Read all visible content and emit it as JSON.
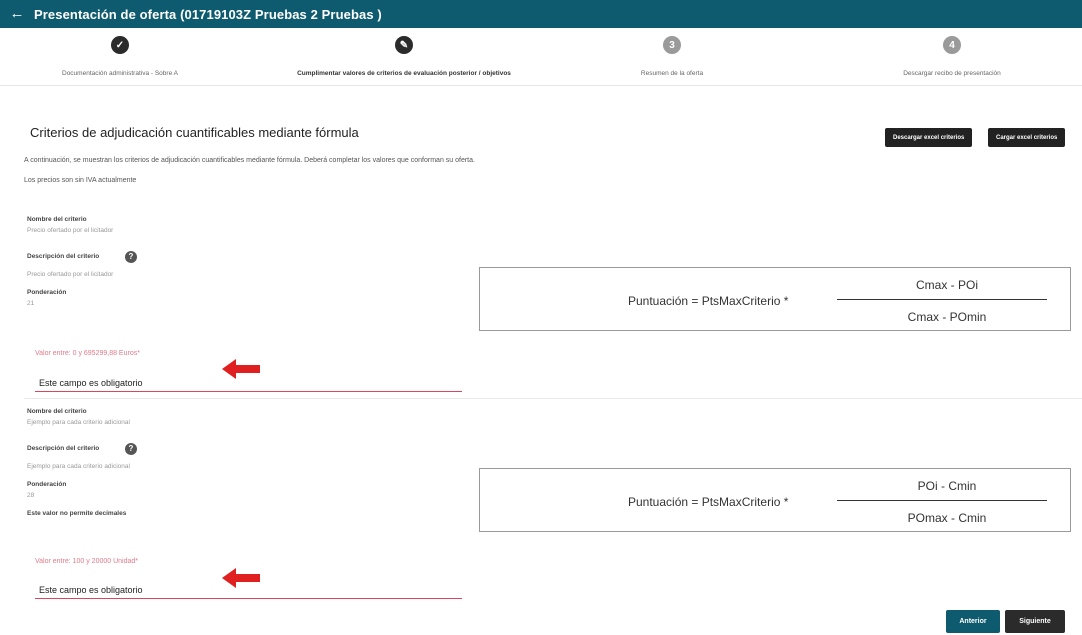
{
  "header": {
    "back_icon": "arrow-left-icon",
    "title": "Presentación de oferta (01719103Z Pruebas 2 Pruebas )"
  },
  "steps": [
    {
      "label": "Documentación administrativa - Sobre A",
      "status": "done",
      "icon": "check-icon",
      "glyph": "✓"
    },
    {
      "label": "Cumplimentar valores de criterios de evaluación posterior / objetivos",
      "status": "done",
      "icon": "edit-icon",
      "glyph": "✎"
    },
    {
      "label": "Resumen de la oferta",
      "status": "todo",
      "icon": "step-3-icon",
      "glyph": "3"
    },
    {
      "label": "Descargar recibo de presentación",
      "status": "todo",
      "icon": "step-4-icon",
      "glyph": "4"
    }
  ],
  "section": {
    "title": "Criterios de adjudicación cuantificables mediante fórmula",
    "download_excel": "Descargar excel criterios",
    "upload_excel": "Cargar excel criterios",
    "intro_text": "A continuación, se muestran los criterios de adjudicación cuantificables mediante fórmula. Deberá completar los valores que conforman su oferta.",
    "vat_note": "Los precios son sin IVA actualmente"
  },
  "criteria": [
    {
      "name_label": "Nombre del criterio",
      "name_value": "Precio ofertado por el licitador",
      "desc_label": "Descripción del criterio",
      "desc_value": "Precio ofertado por el licitador",
      "weight_label": "Ponderación",
      "weight_value": "21",
      "extra_note": "",
      "formula": {
        "lhs": "Puntuación = PtsMaxCriterio  *",
        "numerator": "Cmax - POi",
        "denominator": "Cmax - POmin"
      },
      "field_label": "Valor entre: 0 y 695299,88 Euros*",
      "field_value": "Este campo es obligatorio"
    },
    {
      "name_label": "Nombre del criterio",
      "name_value": "Ejemplo para cada criterio adicional",
      "desc_label": "Descripción del criterio",
      "desc_value": "Ejemplo para cada criterio adicional",
      "weight_label": "Ponderación",
      "weight_value": "28",
      "extra_note": "Este valor no permite decimales",
      "formula": {
        "lhs": "Puntuación = PtsMaxCriterio  *",
        "numerator": "POi - Cmin",
        "denominator": "POmax - Cmin"
      },
      "field_label": "Valor entre: 100 y 20000 Unidad*",
      "field_value": "Este campo es obligatorio"
    }
  ],
  "footer": {
    "prev_label": "Anterior",
    "next_label": "Siguiente"
  },
  "colors": {
    "header_bg": "#0e5a6e",
    "prev_button": "#0e5a6e",
    "next_button": "#2b2b2b",
    "error_red": "#d9465e",
    "annotation_arrow": "#e02020"
  }
}
